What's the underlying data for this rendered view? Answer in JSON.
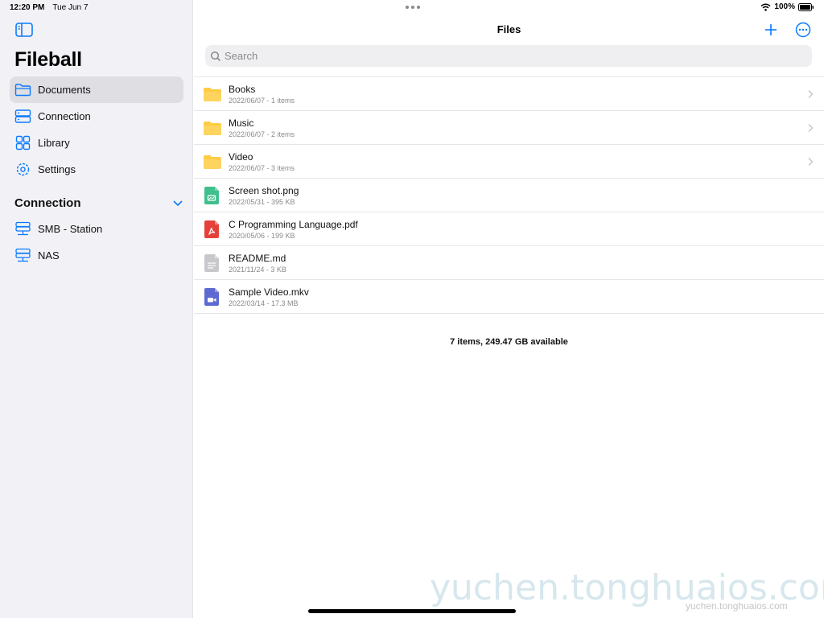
{
  "status": {
    "time": "12:20 PM",
    "date": "Tue Jun 7",
    "battery": "100%"
  },
  "sidebar": {
    "app_title": "Fileball",
    "items": [
      {
        "label": "Documents",
        "icon": "folder-icon",
        "active": true
      },
      {
        "label": "Connection",
        "icon": "server-icon",
        "active": false
      },
      {
        "label": "Library",
        "icon": "grid-icon",
        "active": false
      },
      {
        "label": "Settings",
        "icon": "gear-icon",
        "active": false
      }
    ],
    "section_title": "Connection",
    "connections": [
      {
        "label": "SMB - Station",
        "icon": "network-drive-icon"
      },
      {
        "label": "NAS",
        "icon": "network-drive-icon"
      }
    ]
  },
  "main": {
    "title": "Files",
    "search_placeholder": "Search",
    "files": [
      {
        "name": "Books",
        "meta": "2022/06/07 - 1 items",
        "type": "folder"
      },
      {
        "name": "Music",
        "meta": "2022/06/07 - 2 items",
        "type": "folder"
      },
      {
        "name": "Video",
        "meta": "2022/06/07 - 3 items",
        "type": "folder"
      },
      {
        "name": "Screen shot.png",
        "meta": "2022/05/31 - 395 KB",
        "type": "image"
      },
      {
        "name": "C Programming Language.pdf",
        "meta": "2020/05/06 - 199 KB",
        "type": "pdf"
      },
      {
        "name": "README.md",
        "meta": "2021/11/24 - 3 KB",
        "type": "text"
      },
      {
        "name": "Sample Video.mkv",
        "meta": "2022/03/14 - 17.3 MB",
        "type": "video"
      }
    ],
    "footer": "7 items, 249.47 GB available"
  },
  "watermark": {
    "large": "yuchen.tonghuaios.com",
    "small": "yuchen.tonghuaios.com"
  },
  "colors": {
    "accent": "#0a7aff",
    "folder": "#ffcb45",
    "image": "#3fc08c",
    "pdf": "#e5413b",
    "text": "#c7c7cc",
    "video": "#5e6ad2"
  }
}
